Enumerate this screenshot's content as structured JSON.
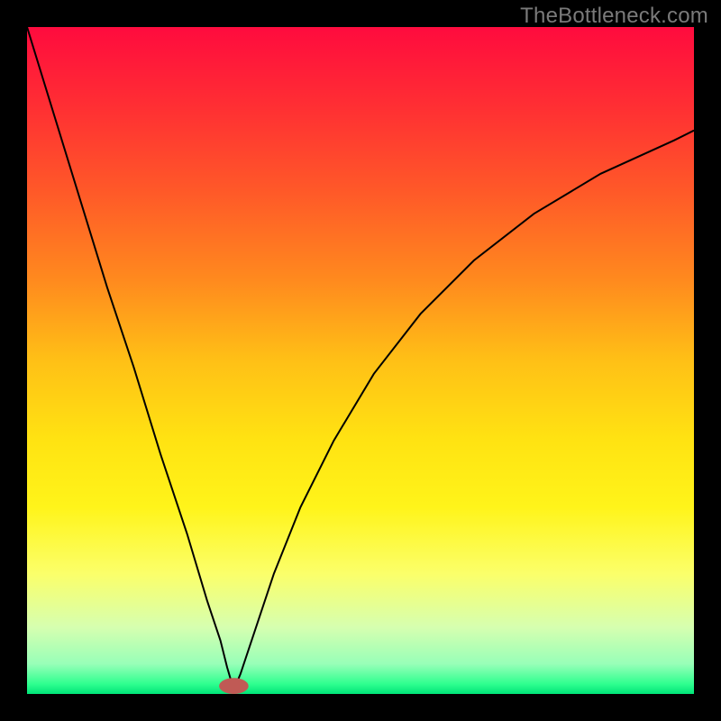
{
  "watermark": "TheBottleneck.com",
  "chart_data": {
    "type": "line",
    "title": "",
    "xlabel": "",
    "ylabel": "",
    "xlim": [
      0,
      100
    ],
    "ylim": [
      0,
      100
    ],
    "grid": false,
    "legend": false,
    "annotations": [],
    "background": {
      "type": "vertical-gradient",
      "stops": [
        {
          "offset": 0.0,
          "color": "#ff0b3e"
        },
        {
          "offset": 0.12,
          "color": "#ff2f33"
        },
        {
          "offset": 0.25,
          "color": "#ff5a28"
        },
        {
          "offset": 0.38,
          "color": "#ff8a1e"
        },
        {
          "offset": 0.5,
          "color": "#ffc016"
        },
        {
          "offset": 0.62,
          "color": "#ffe312"
        },
        {
          "offset": 0.72,
          "color": "#fff41a"
        },
        {
          "offset": 0.82,
          "color": "#fbff6a"
        },
        {
          "offset": 0.9,
          "color": "#d6ffb0"
        },
        {
          "offset": 0.955,
          "color": "#98ffb8"
        },
        {
          "offset": 0.985,
          "color": "#2fff8f"
        },
        {
          "offset": 1.0,
          "color": "#00e478"
        }
      ]
    },
    "marker": {
      "x": 31,
      "y": 1.2,
      "color": "#c05a55",
      "rx": 2.2,
      "ry": 1.2
    },
    "series": [
      {
        "name": "curve",
        "color": "#000000",
        "width": 2,
        "x": [
          0,
          4,
          8,
          12,
          16,
          20,
          24,
          27,
          29,
          30,
          31,
          32,
          34,
          37,
          41,
          46,
          52,
          59,
          67,
          76,
          86,
          97,
          100
        ],
        "y": [
          100,
          87,
          74,
          61,
          49,
          36,
          24,
          14,
          8,
          4,
          0.6,
          3,
          9,
          18,
          28,
          38,
          48,
          57,
          65,
          72,
          78,
          83,
          84.5
        ]
      }
    ]
  }
}
